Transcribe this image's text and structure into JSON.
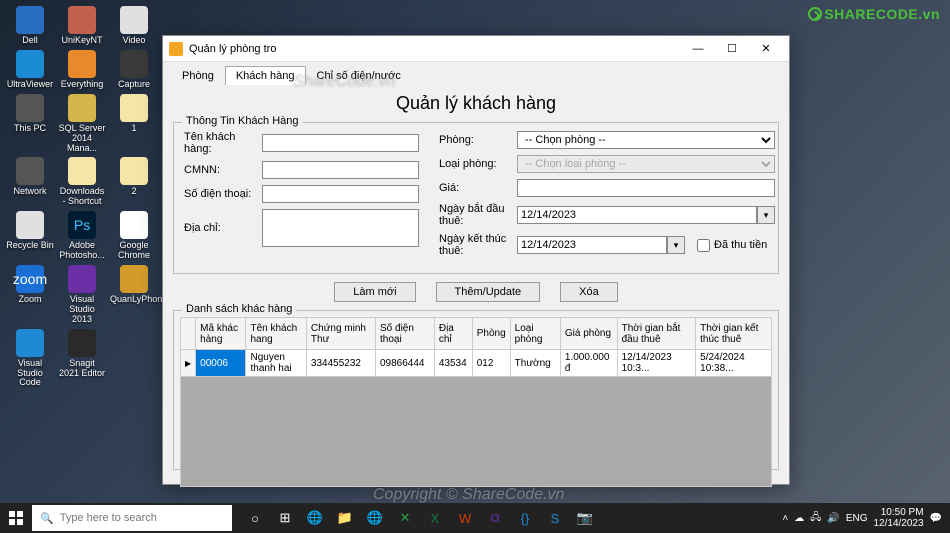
{
  "desktop_icons": [
    {
      "label": "Dell",
      "bg": "#2a6fbf"
    },
    {
      "label": "UniKeyNT",
      "bg": "#c2624e"
    },
    {
      "label": "Video",
      "bg": "#e0e0e0"
    },
    {
      "label": "UltraViewer",
      "bg": "#1b8bd4"
    },
    {
      "label": "Everything",
      "bg": "#e88a2a"
    },
    {
      "label": "Capture",
      "bg": "#3a3a3a"
    },
    {
      "label": "This PC",
      "bg": "#555"
    },
    {
      "label": "SQL Server 2014 Mana...",
      "bg": "#d4b54a"
    },
    {
      "label": "1",
      "bg": "#f5e6a8"
    },
    {
      "label": "Network",
      "bg": "#555"
    },
    {
      "label": "Downloads - Shortcut",
      "bg": "#f5e6a8"
    },
    {
      "label": "2",
      "bg": "#f5e6a8"
    },
    {
      "label": "Recycle Bin",
      "bg": "#e0e0e0"
    },
    {
      "label": "Adobe Photosho...",
      "bg": "#001d33",
      "txt": "Ps",
      "tc": "#3cc1ff"
    },
    {
      "label": "Google Chrome",
      "bg": "#fff"
    },
    {
      "label": "Zoom",
      "bg": "#1a6fd4",
      "txt": "zoom",
      "tc": "#fff"
    },
    {
      "label": "Visual Studio 2013",
      "bg": "#6a2fa5"
    },
    {
      "label": "QuanLyPhon...",
      "bg": "#d49a2a"
    },
    {
      "label": "Visual Studio Code",
      "bg": "#1f8ad4"
    },
    {
      "label": "Snagit 2021 Editor",
      "bg": "#2a2a2a"
    }
  ],
  "logo": "SHARECODE.vn",
  "window": {
    "title": "Quản lý phòng tro",
    "tabs": [
      "Phòng",
      "Khách hàng",
      "Chỉ số điện/nước"
    ],
    "active_tab": 1,
    "page_title": "Quản lý khách hàng",
    "group_info": "Thông Tin Khách Hàng",
    "labels": {
      "ten": "Tên khách hàng:",
      "cmnn": "CMNN:",
      "sdt": "Số điện thoại:",
      "diachi": "Địa chỉ:",
      "phong": "Phòng:",
      "loaiphong": "Loại phòng:",
      "gia": "Giá:",
      "ngaybd": "Ngày bắt đầu thuê:",
      "ngaykt": "Ngày kết thúc thuê:",
      "dathu": "Đã thu tiền"
    },
    "values": {
      "phong_sel": "-- Chọn phòng --",
      "loai_sel": "-- Chọn loại phòng --",
      "date1": "12/14/2023",
      "date2": "12/14/2023"
    },
    "buttons": {
      "lammoi": "Làm mới",
      "them": "Thêm/Update",
      "xoa": "Xóa"
    },
    "grid": {
      "title": "Danh sách khác hàng",
      "headers": [
        "Mã khác hàng",
        "Tên khách hang",
        "Chứng minh Thư",
        "Số điện thoại",
        "Địa chỉ",
        "Phòng",
        "Loại phòng",
        "Giá phòng",
        "Thời gian bắt đầu thuê",
        "Thời gian kết thúc thuê"
      ],
      "row": [
        "00006",
        "Nguyen thanh hai",
        "334455232",
        "09866444",
        "43534",
        "012",
        "Thường",
        "1.000.000 đ",
        "12/14/2023 10:3...",
        "5/24/2024 10:38..."
      ]
    }
  },
  "watermarks": {
    "w1": "ShareCode.vn",
    "w2": "Copyright © ShareCode.vn"
  },
  "taskbar": {
    "search_placeholder": "Type here to search",
    "time": "10:50 PM",
    "date": "12/14/2023"
  }
}
